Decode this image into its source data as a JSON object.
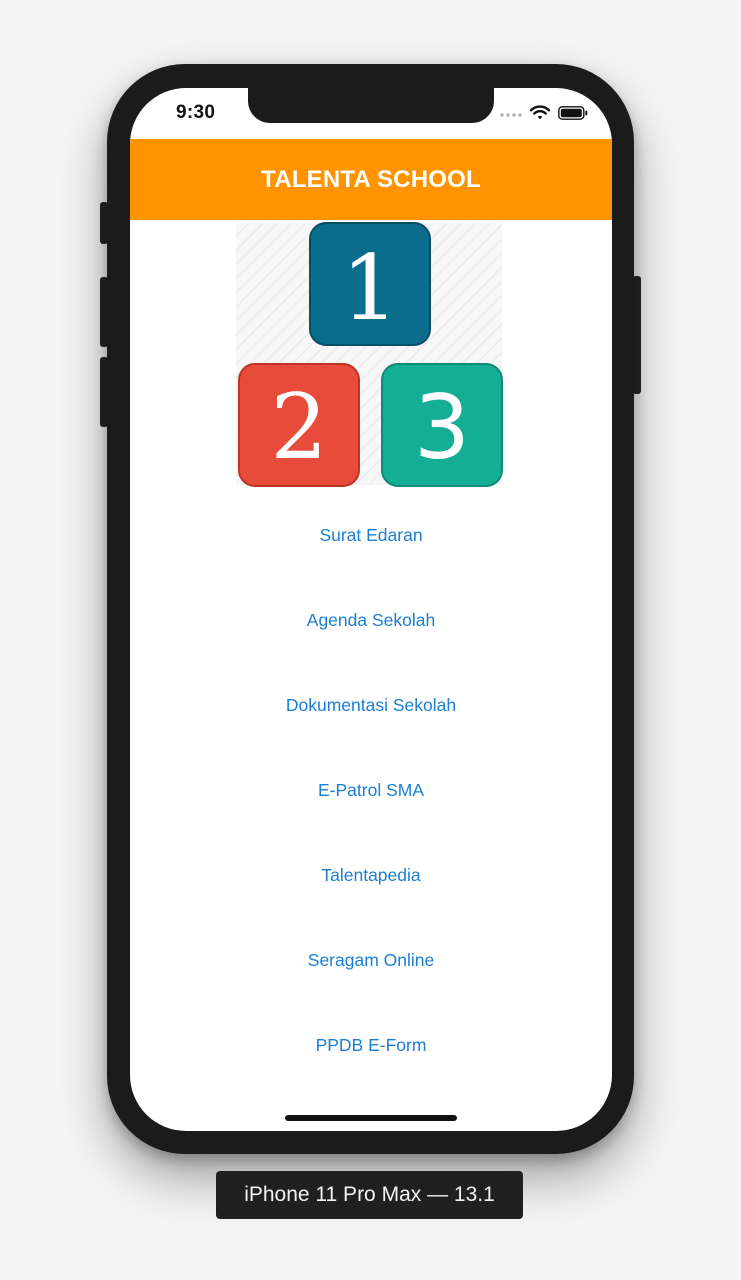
{
  "status_bar": {
    "time": "9:30"
  },
  "header": {
    "title": "TALENTA SCHOOL",
    "background_color": "#ff9300"
  },
  "logo": {
    "tiles": [
      {
        "digit": "1",
        "color": "#0b6d8c"
      },
      {
        "digit": "2",
        "color": "#e84b39"
      },
      {
        "digit": "3",
        "color": "#14ae94"
      }
    ]
  },
  "menu": {
    "link_color": "#1a7fd4",
    "items": [
      {
        "label": "Surat Edaran"
      },
      {
        "label": "Agenda Sekolah"
      },
      {
        "label": "Dokumentasi Sekolah"
      },
      {
        "label": "E-Patrol SMA"
      },
      {
        "label": "Talentapedia"
      },
      {
        "label": "Seragam Online"
      },
      {
        "label": "PPDB E-Form"
      }
    ]
  },
  "device_label": "iPhone 11 Pro Max — 13.1"
}
